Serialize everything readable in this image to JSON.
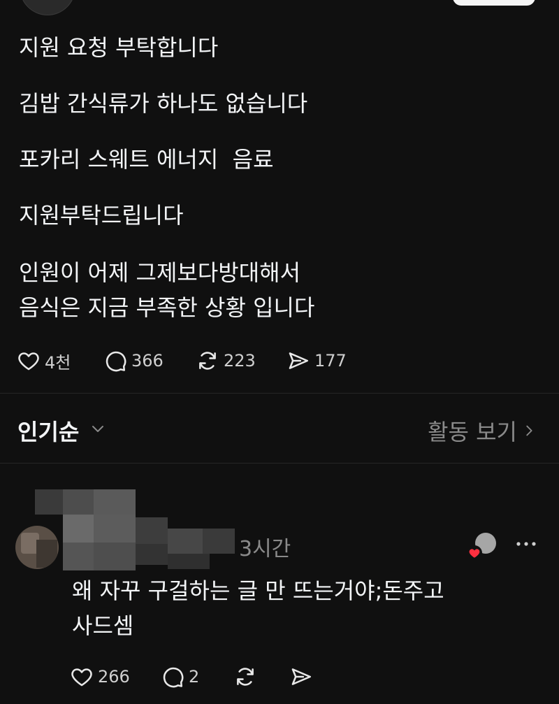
{
  "post": {
    "lines": [
      "지원 요청 부탁합니다",
      "김밥 간식류가 하나도 없습니다",
      "포카리 스웨트 에너지  음료",
      "지원부탁드립니다",
      "인원이 어제 그제보다방대해서",
      "음식은 지금 부족한 상황 입니다"
    ],
    "actions": {
      "likes": "4천",
      "comments": "366",
      "reposts": "223",
      "shares": "177"
    }
  },
  "sort": {
    "label": "인기순",
    "activity_link": "활동 보기"
  },
  "comment": {
    "time": "3시간",
    "lines": [
      "왜 자꾸 구걸하는 글 만 뜨는거야;돈주고",
      "사드셈"
    ],
    "actions": {
      "likes": "266",
      "comments": "2"
    }
  },
  "colors": {
    "background": "#101010",
    "text": "#f3f5f7",
    "muted": "#8a8a8a",
    "heart_badge": "#ff3040"
  },
  "icons": {
    "like": "heart-icon",
    "comment": "speech-bubble-icon",
    "repost": "repost-icon",
    "share": "send-icon",
    "sort": "chevron-down-icon",
    "activity": "chevron-right-icon",
    "more": "more-dots-icon"
  }
}
